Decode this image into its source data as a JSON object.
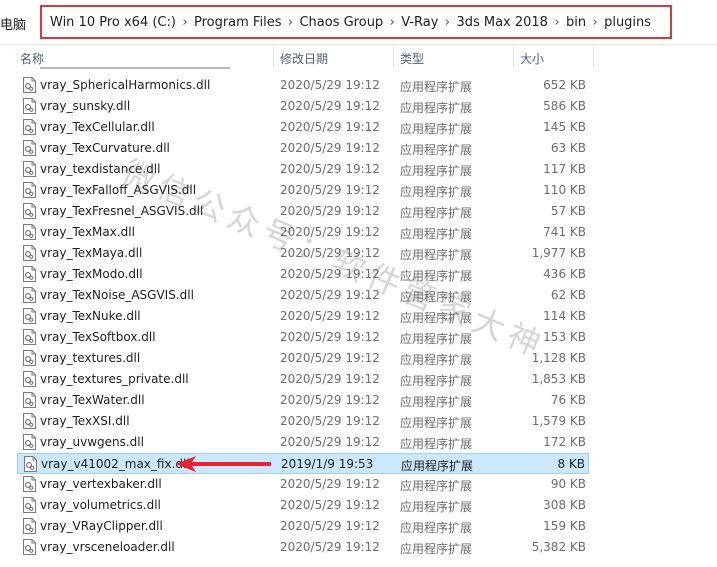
{
  "address": {
    "left_text": "电脑",
    "crumbs": [
      "Win 10 Pro x64 (C:)",
      "Program Files",
      "Chaos Group",
      "V-Ray",
      "3ds Max 2018",
      "bin",
      "plugins"
    ]
  },
  "columns": {
    "name": "名称",
    "date": "修改日期",
    "type": "类型",
    "size": "大小"
  },
  "files": [
    {
      "name": "vray_SphericalHarmonics.dll",
      "date": "2020/5/29 19:12",
      "type": "应用程序扩展",
      "size": "652 KB"
    },
    {
      "name": "vray_sunsky.dll",
      "date": "2020/5/29 19:12",
      "type": "应用程序扩展",
      "size": "586 KB"
    },
    {
      "name": "vray_TexCellular.dll",
      "date": "2020/5/29 19:12",
      "type": "应用程序扩展",
      "size": "145 KB"
    },
    {
      "name": "vray_TexCurvature.dll",
      "date": "2020/5/29 19:12",
      "type": "应用程序扩展",
      "size": "63 KB"
    },
    {
      "name": "vray_texdistance.dll",
      "date": "2020/5/29 19:12",
      "type": "应用程序扩展",
      "size": "117 KB"
    },
    {
      "name": "vray_TexFalloff_ASGVIS.dll",
      "date": "2020/5/29 19:12",
      "type": "应用程序扩展",
      "size": "110 KB"
    },
    {
      "name": "vray_TexFresnel_ASGVIS.dll",
      "date": "2020/5/29 19:12",
      "type": "应用程序扩展",
      "size": "57 KB"
    },
    {
      "name": "vray_TexMax.dll",
      "date": "2020/5/29 19:12",
      "type": "应用程序扩展",
      "size": "741 KB"
    },
    {
      "name": "vray_TexMaya.dll",
      "date": "2020/5/29 19:12",
      "type": "应用程序扩展",
      "size": "1,977 KB"
    },
    {
      "name": "vray_TexModo.dll",
      "date": "2020/5/29 19:12",
      "type": "应用程序扩展",
      "size": "436 KB"
    },
    {
      "name": "vray_TexNoise_ASGVIS.dll",
      "date": "2020/5/29 19:12",
      "type": "应用程序扩展",
      "size": "62 KB"
    },
    {
      "name": "vray_TexNuke.dll",
      "date": "2020/5/29 19:12",
      "type": "应用程序扩展",
      "size": "114 KB"
    },
    {
      "name": "vray_TexSoftbox.dll",
      "date": "2020/5/29 19:12",
      "type": "应用程序扩展",
      "size": "153 KB"
    },
    {
      "name": "vray_textures.dll",
      "date": "2020/5/29 19:12",
      "type": "应用程序扩展",
      "size": "1,128 KB"
    },
    {
      "name": "vray_textures_private.dll",
      "date": "2020/5/29 19:12",
      "type": "应用程序扩展",
      "size": "1,853 KB"
    },
    {
      "name": "vray_TexWater.dll",
      "date": "2020/5/29 19:12",
      "type": "应用程序扩展",
      "size": "76 KB"
    },
    {
      "name": "vray_TexXSI.dll",
      "date": "2020/5/29 19:12",
      "type": "应用程序扩展",
      "size": "1,579 KB"
    },
    {
      "name": "vray_uvwgens.dll",
      "date": "2020/5/29 19:12",
      "type": "应用程序扩展",
      "size": "172 KB"
    },
    {
      "name": "vray_v41002_max_fix.dll",
      "date": "2019/1/9 19:53",
      "type": "应用程序扩展",
      "size": "8 KB",
      "selected": true
    },
    {
      "name": "vray_vertexbaker.dll",
      "date": "2020/5/29 19:12",
      "type": "应用程序扩展",
      "size": "90 KB"
    },
    {
      "name": "vray_volumetrics.dll",
      "date": "2020/5/29 19:12",
      "type": "应用程序扩展",
      "size": "308 KB"
    },
    {
      "name": "vray_VRayClipper.dll",
      "date": "2020/5/29 19:12",
      "type": "应用程序扩展",
      "size": "159 KB"
    },
    {
      "name": "vray_vrsceneloader.dll",
      "date": "2020/5/29 19:12",
      "type": "应用程序扩展",
      "size": "5,382 KB"
    }
  ],
  "watermark": "微信公众号：软件管家大神",
  "colors": {
    "highlight_border": "#d63a3a",
    "selection_bg": "#cce8ff",
    "selection_border": "#99d1ff",
    "arrow": "#e8232b"
  },
  "icons": {
    "file": "dll-file-icon",
    "separator": "chevron-right-icon",
    "pointer": "red-arrow-icon"
  }
}
